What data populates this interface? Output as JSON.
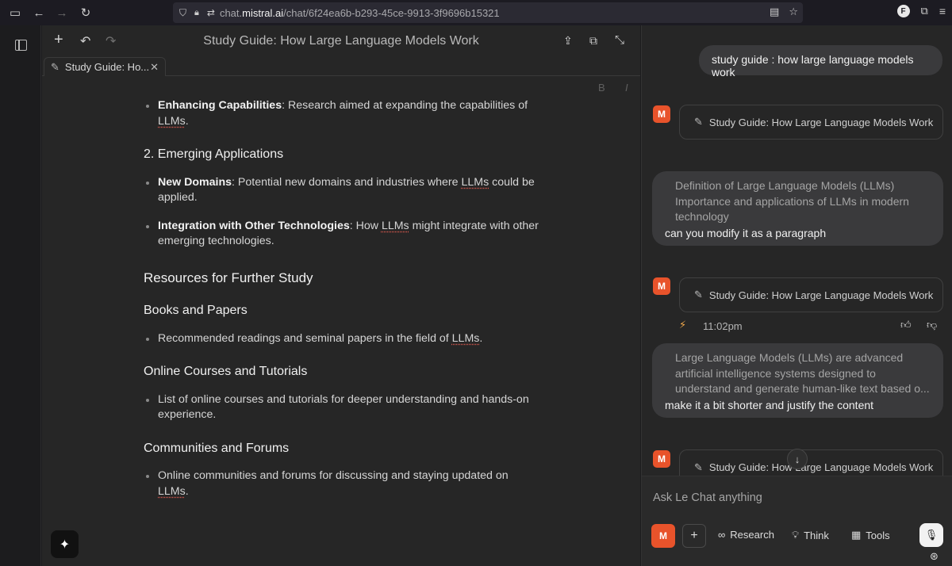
{
  "browser": {
    "url_prefix": "chat.",
    "url_host": "mistral.ai",
    "url_path": "/chat/6f24ea6b-b293-45ce-9913-3f9696b15321",
    "profile_initial": "F"
  },
  "editor": {
    "doc_title": "Study Guide: How Large Language Models Work",
    "tab_label": "Study Guide: Ho...",
    "format_bold": "B",
    "format_italic": "I",
    "content": {
      "b1_bold": "Enhancing Capabilities",
      "b1_text": ": Research aimed at expanding the capabilities of ",
      "b1_llm": "LLMs",
      "b1_end": ".",
      "h_emerging": "2. Emerging Applications",
      "b2_bold": "New Domains",
      "b2_text": ": Potential new domains and industries where ",
      "b2_llm": "LLMs",
      "b2_end": " could be applied.",
      "b3_bold": "Integration with Other Technologies",
      "b3_text": ": How ",
      "b3_llm": "LLMs",
      "b3_end": " might integrate with other emerging technologies.",
      "h_resources": "Resources for Further Study",
      "h_books": "Books and Papers",
      "b4_text": "Recommended readings and seminal papers in the field of ",
      "b4_llm": "LLMs",
      "b4_end": ".",
      "h_courses": "Online Courses and Tutorials",
      "b5_text": "List of online courses and tutorials for deeper understanding and hands-on experience.",
      "h_communities": "Communities and Forums",
      "b6_text": "Online communities and forums for discussing and staying updated on ",
      "b6_llm": "LLMs",
      "b6_end": "."
    }
  },
  "chat": {
    "msg1": "study guide : how large language models work",
    "artifact_label": "Study Guide: How Large Language Models Work",
    "msg2_quote_1": "Definition of Large Language Models (LLMs)",
    "msg2_quote_2": "Importance and applications of LLMs in modern",
    "msg2_quote_3": "technology",
    "msg2_text": "can you modify it as a paragraph",
    "timestamp": "11:02pm",
    "msg3_quote_1": "Large Language Models (LLMs) are advanced",
    "msg3_quote_2": "artificial intelligence systems designed to",
    "msg3_quote_3": "understand and generate human-like text based o...",
    "msg3_text": "make it a bit shorter and justify the content",
    "composer_placeholder": "Ask Le Chat anything",
    "research_label": "Research",
    "think_label": "Think",
    "tools_label": "Tools",
    "logo_glyph": "M"
  },
  "colors": {
    "accent": "#e8532b",
    "spellcheck": "#e05a4f"
  }
}
